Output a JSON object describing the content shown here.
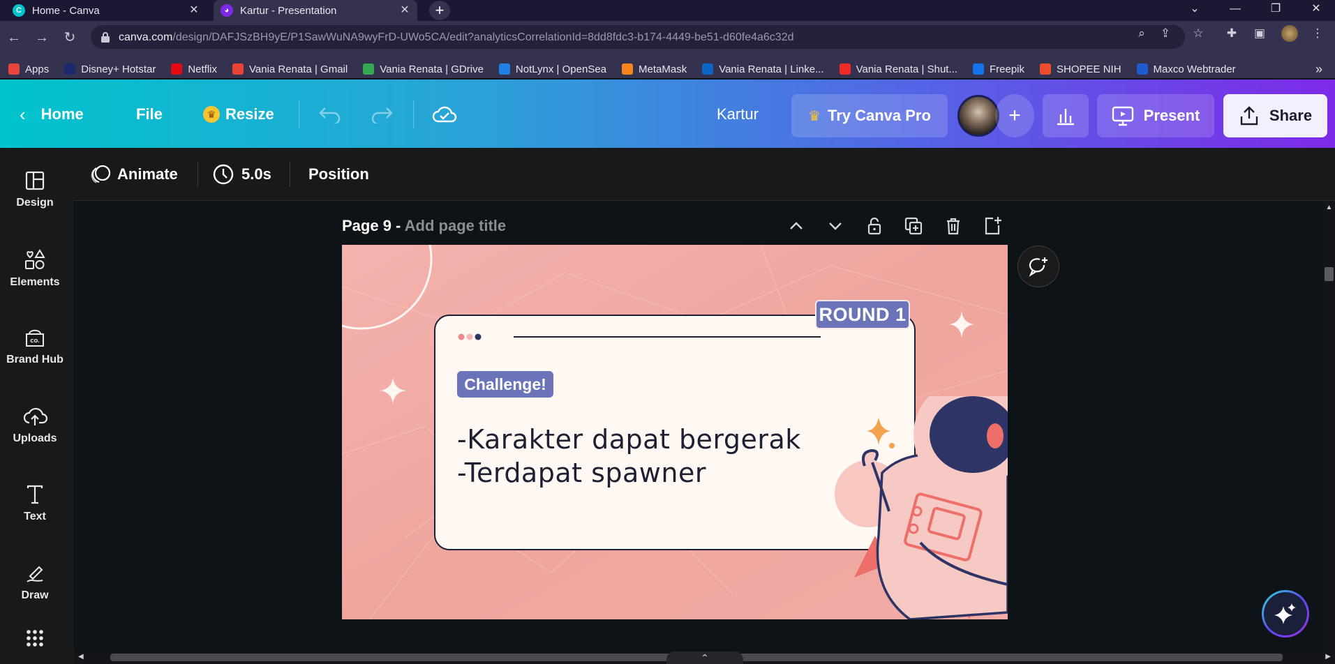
{
  "browser": {
    "tabs": [
      {
        "title": "Home - Canva",
        "active": false
      },
      {
        "title": "Kartur - Presentation",
        "active": true
      }
    ],
    "url_domain": "canva.com",
    "url_path": "/design/DAFJSzBH9yE/P1SawWuNA9wyFrD-UWo5CA/edit?analyticsCorrelationId=8dd8fdc3-b174-4449-be51-d60fe4a6c32d",
    "bookmarks": [
      {
        "label": "Apps",
        "color": "#e8453c"
      },
      {
        "label": "Disney+ Hotstar",
        "color": "#1a2a6c"
      },
      {
        "label": "Netflix",
        "color": "#e50914"
      },
      {
        "label": "Vania Renata | Gmail",
        "color": "#ea4335"
      },
      {
        "label": "Vania Renata | GDrive",
        "color": "#34a853"
      },
      {
        "label": "NotLynx | OpenSea",
        "color": "#2081e2"
      },
      {
        "label": "MetaMask",
        "color": "#f6851b"
      },
      {
        "label": "Vania Renata | Linke...",
        "color": "#0a66c2"
      },
      {
        "label": "Vania Renata | Shut...",
        "color": "#ee2b24"
      },
      {
        "label": "Freepik",
        "color": "#1273eb"
      },
      {
        "label": "SHOPEE NIH",
        "color": "#ee4d2d"
      },
      {
        "label": "Maxco Webtrader",
        "color": "#1e5bd0"
      }
    ]
  },
  "header": {
    "home": "Home",
    "file": "File",
    "resize": "Resize",
    "doc_title": "Kartur",
    "try_pro": "Try Canva Pro",
    "present": "Present",
    "share": "Share"
  },
  "sidebar": {
    "items": [
      {
        "label": "Design",
        "icon": "layout-icon"
      },
      {
        "label": "Elements",
        "icon": "shapes-icon"
      },
      {
        "label": "Brand Hub",
        "icon": "brand-icon"
      },
      {
        "label": "Uploads",
        "icon": "cloud-upload-icon"
      },
      {
        "label": "Text",
        "icon": "text-icon"
      },
      {
        "label": "Draw",
        "icon": "pen-icon"
      }
    ]
  },
  "toolbar": {
    "animate": "Animate",
    "duration": "5.0s",
    "position": "Position"
  },
  "page": {
    "label": "Page 9 - ",
    "title_placeholder": "Add page title"
  },
  "slide": {
    "round_label": "ROUND 1",
    "challenge_label": "Challenge!",
    "lines": [
      "-Karakter dapat bergerak",
      "-Terdapat spawner"
    ],
    "colors": {
      "background": "#f1a9a3",
      "card": "#fff8f3",
      "accent": "#6b74b8",
      "navy": "#2e3566"
    }
  }
}
